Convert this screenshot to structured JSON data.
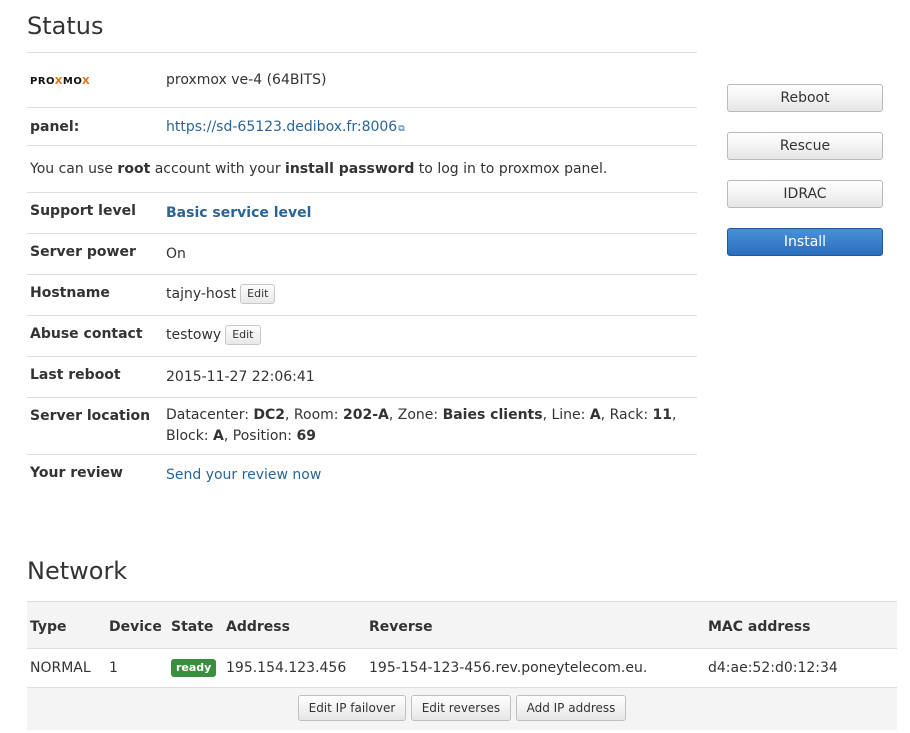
{
  "status": {
    "heading": "Status",
    "os_logo": {
      "pre": "PRO",
      "x1": "X",
      "mid": "MO",
      "x2": "X"
    },
    "os_name": "proxmox ve-4 (64BITS)",
    "panel_label": "panel:",
    "panel_url": "https://sd-65123.dedibox.fr:8006",
    "info": {
      "t1": "You can use ",
      "b1": "root",
      "t2": " account with your ",
      "b2": "install password",
      "t3": " to log in to proxmox panel."
    },
    "support_label": "Support level",
    "support_value": "Basic service level",
    "power_label": "Server power",
    "power_value": "On",
    "hostname_label": "Hostname",
    "hostname_value": "tajny-host",
    "abuse_label": "Abuse contact",
    "abuse_value": "testowy",
    "edit_label": "Edit",
    "reboot_label": "Last reboot",
    "reboot_value": "2015-11-27 22:06:41",
    "location_label": "Server location",
    "location": {
      "dc_k": "Datacenter: ",
      "dc_v": "DC2",
      "room_k": ", Room: ",
      "room_v": "202-A",
      "zone_k": ", Zone: ",
      "zone_v": "Baies clients",
      "line_k": ", Line: ",
      "line_v": "A",
      "rack_k": ", Rack: ",
      "rack_v": "11",
      "block_k": ", Block: ",
      "block_v": "A",
      "pos_k": ", Position: ",
      "pos_v": "69"
    },
    "review_label": "Your review",
    "review_link": "Send your review now"
  },
  "actions": {
    "reboot": "Reboot",
    "rescue": "Rescue",
    "idrac": "IDRAC",
    "install": "Install"
  },
  "network": {
    "heading": "Network",
    "columns": {
      "type": "Type",
      "device": "Device",
      "state": "State",
      "address": "Address",
      "reverse": "Reverse",
      "mac": "MAC address"
    },
    "rows": [
      {
        "type": "NORMAL",
        "device": "1",
        "state": "ready",
        "address": "195.154.123.456",
        "reverse": "195-154-123-456.rev.poneytelecom.eu.",
        "mac": "d4:ae:52:d0:12:34"
      }
    ],
    "buttons": {
      "failover": "Edit IP failover",
      "reverses": "Edit reverses",
      "add_ip": "Add IP address"
    }
  }
}
